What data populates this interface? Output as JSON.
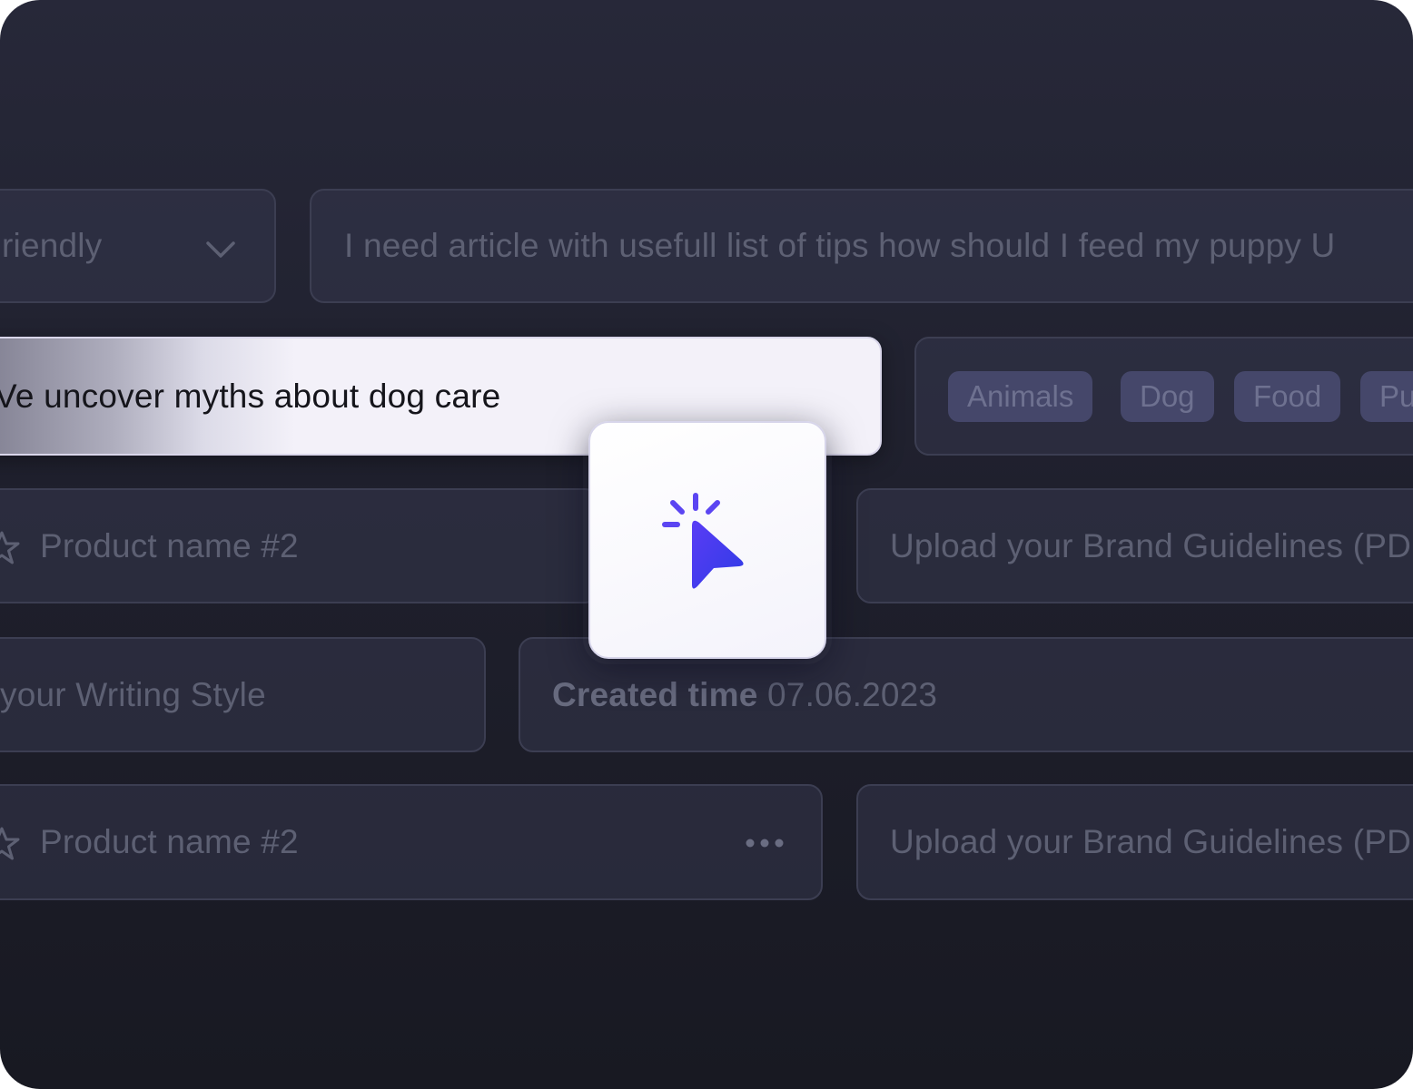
{
  "tone_select": {
    "value": "riendly",
    "icon": "chevron-down-icon"
  },
  "prompt_field": {
    "value": "I need article with usefull list of tips how should I feed my puppy U"
  },
  "title_field": {
    "value": "Ve uncover myths about dog care"
  },
  "tags": [
    {
      "label": "Animals"
    },
    {
      "label": "Dog"
    },
    {
      "label": "Food"
    },
    {
      "label": "Pu"
    }
  ],
  "product_rows": [
    {
      "label": "Product name #2",
      "icon": "star-icon"
    },
    {
      "label": "Product name #2",
      "icon": "star-icon",
      "menu_icon": "more-horizontal-icon"
    }
  ],
  "upload_fields": [
    {
      "label": "Upload your Brand Guidelines (PD"
    },
    {
      "label": "Upload your Brand Guidelines (PD"
    }
  ],
  "writing_style": {
    "label": "your Writing Style"
  },
  "created_time": {
    "label": "Created time",
    "value": "07.06.2023"
  },
  "cursor_card": {
    "icon": "cursor-click-icon",
    "accent_color": "#4b3bf0"
  },
  "colors": {
    "background": "#222333",
    "field_border": "#3c3e52",
    "tag_bg": "#45476a",
    "muted_text": "#5d6073"
  }
}
